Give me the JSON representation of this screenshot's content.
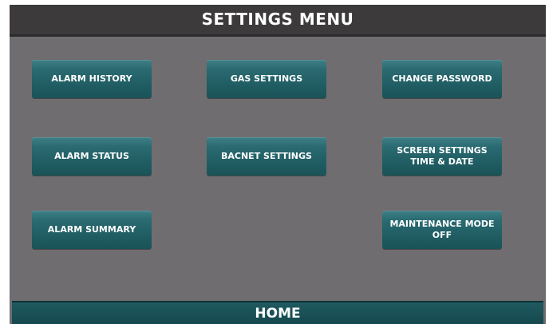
{
  "header": {
    "title": "SETTINGS MENU"
  },
  "menu": {
    "alarm_history": "ALARM HISTORY",
    "gas_settings": "GAS SETTINGS",
    "change_password": "CHANGE PASSWORD",
    "alarm_status": "ALARM STATUS",
    "bacnet_settings": "BACNET SETTINGS",
    "screen_settings_line1": "SCREEN SETTINGS",
    "screen_settings_line2": "TIME & DATE",
    "alarm_summary": "ALARM SUMMARY",
    "maintenance_mode": "MAINTENANCE MODE OFF"
  },
  "footer": {
    "home_label": "HOME"
  },
  "colors": {
    "panel_background": "#6f6d70",
    "title_bar": "#3d3a3c",
    "button_teal": "#2a6a71",
    "home_bar": "#1a5257",
    "text": "#ffffff"
  }
}
